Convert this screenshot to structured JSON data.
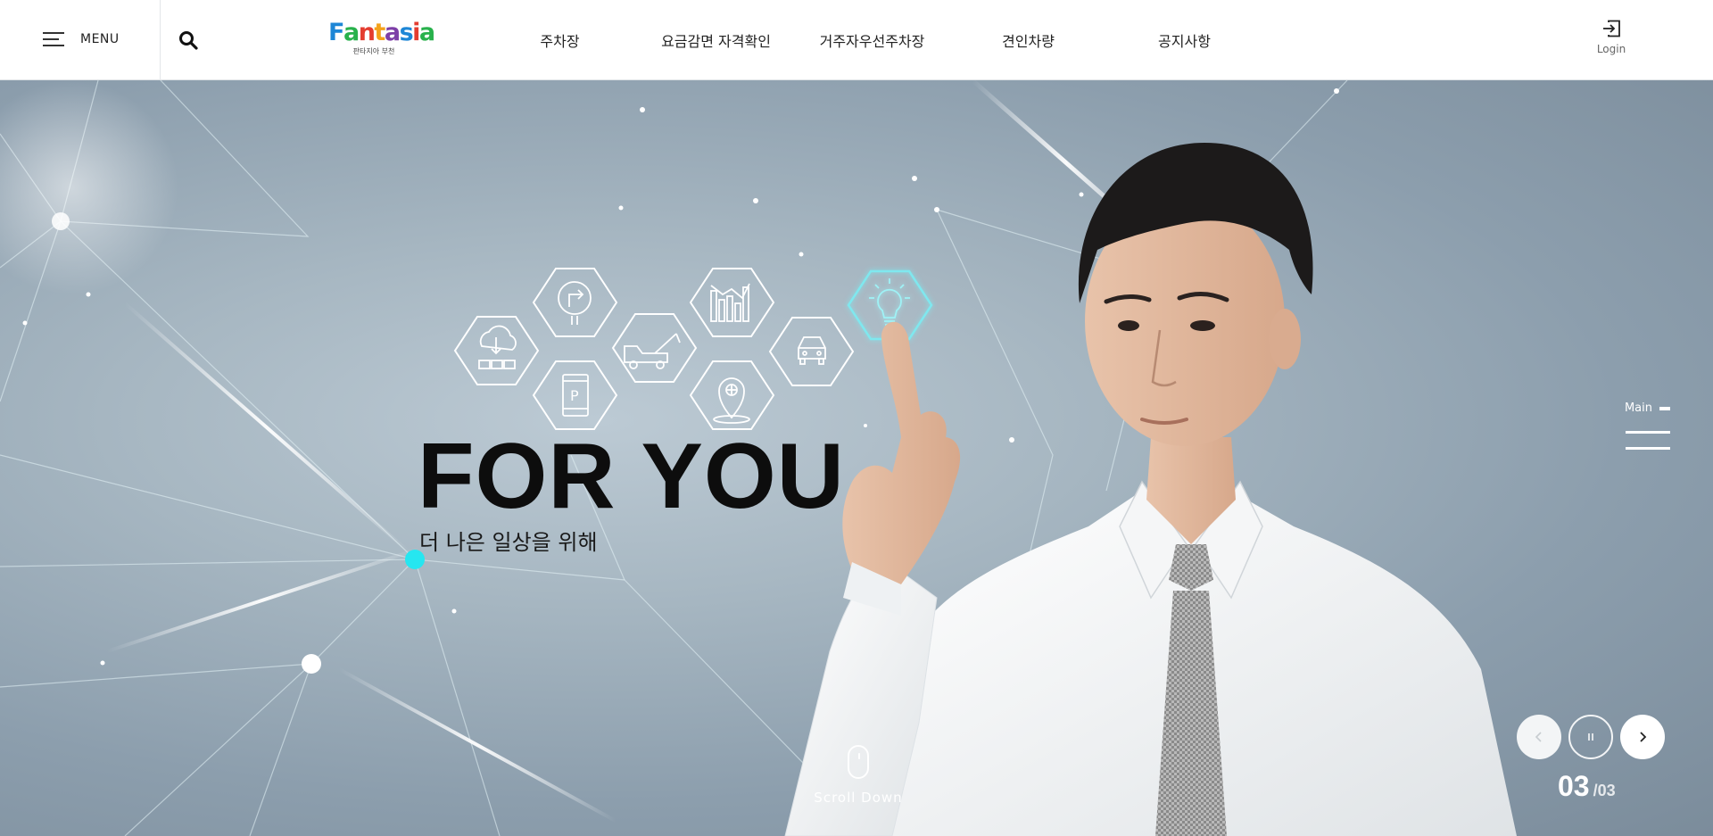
{
  "header": {
    "menu_label": "MENU",
    "logo_text": "Fantasia",
    "logo_sub": "판타지아 부천",
    "nav": [
      "주차장",
      "요금감면 자격확인",
      "거주자우선주차장",
      "견인차량",
      "공지사항"
    ],
    "login_label": "Login"
  },
  "hero": {
    "headline": "FOR YOU",
    "subline": "더 나은 일상을 위해",
    "scroll_label": "Scroll Down",
    "side_nav_label": "Main",
    "slide_current": "03",
    "slide_separator": "/",
    "slide_total": "03",
    "icons": [
      "cloud-download-icon",
      "turn-right-sign-icon",
      "parking-phone-icon",
      "tow-truck-icon",
      "bar-chart-icon",
      "location-pin-icon",
      "car-icon",
      "lightbulb-icon"
    ],
    "colors": {
      "accent": "#26e6f0",
      "highlight_hex": "#7fe8ef"
    }
  }
}
